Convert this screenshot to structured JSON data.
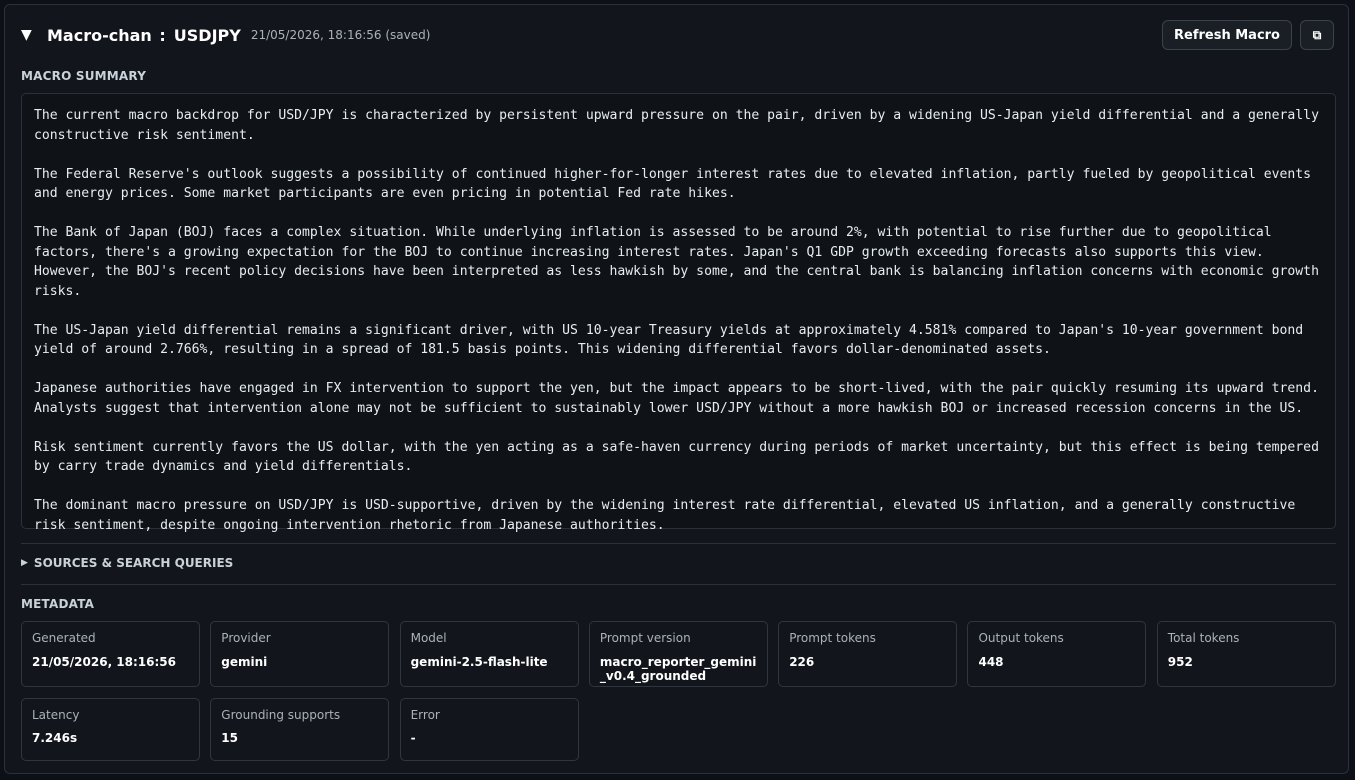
{
  "header": {
    "title": "Macro-chan",
    "separator": ":",
    "symbol": "USDJPY",
    "timestamp": "21/05/2026, 18:16:56 (saved)",
    "toggle_glyph": "▼",
    "refresh_label": "Refresh Macro",
    "copy_glyph": "⧉",
    "copy_icon": "copy-icon"
  },
  "summary": {
    "label": "MACRO SUMMARY",
    "paragraphs": [
      "The current macro backdrop for USD/JPY is characterized by persistent upward pressure on the pair, driven by a widening US-Japan yield differential and a generally constructive risk sentiment.",
      "The Federal Reserve's outlook suggests a possibility of continued higher-for-longer interest rates due to elevated inflation, partly fueled by geopolitical events and energy prices. Some market participants are even pricing in potential Fed rate hikes.",
      "The Bank of Japan (BOJ) faces a complex situation. While underlying inflation is assessed to be around 2%, with potential to rise further due to geopolitical factors, there's a growing expectation for the BOJ to continue increasing interest rates. Japan's Q1 GDP growth exceeding forecasts also supports this view. However, the BOJ's recent policy decisions have been interpreted as less hawkish by some, and the central bank is balancing inflation concerns with economic growth risks.",
      "The US-Japan yield differential remains a significant driver, with US 10-year Treasury yields at approximately 4.581% compared to Japan's 10-year government bond yield of around 2.766%, resulting in a spread of 181.5 basis points. This widening differential favors dollar-denominated assets.",
      "Japanese authorities have engaged in FX intervention to support the yen, but the impact appears to be short-lived, with the pair quickly resuming its upward trend. Analysts suggest that intervention alone may not be sufficient to sustainably lower USD/JPY without a more hawkish BOJ or increased recession concerns in the US.",
      "Risk sentiment currently favors the US dollar, with the yen acting as a safe-haven currency during periods of market uncertainty, but this effect is being tempered by carry trade dynamics and yield differentials.",
      "The dominant macro pressure on USD/JPY is USD-supportive, driven by the widening interest rate differential, elevated US inflation, and a generally constructive risk sentiment, despite ongoing intervention rhetoric from Japanese authorities."
    ]
  },
  "sources": {
    "label": "SOURCES & SEARCH QUERIES",
    "glyph": "▶"
  },
  "metadata": {
    "label": "METADATA",
    "items": [
      {
        "key": "Generated",
        "value": "21/05/2026, 18:16:56"
      },
      {
        "key": "Provider",
        "value": "gemini"
      },
      {
        "key": "Model",
        "value": "gemini-2.5-flash-lite"
      },
      {
        "key": "Prompt version",
        "value": "macro_reporter_gemini_v0.4_grounded"
      },
      {
        "key": "Prompt tokens",
        "value": "226"
      },
      {
        "key": "Output tokens",
        "value": "448"
      },
      {
        "key": "Total tokens",
        "value": "952"
      },
      {
        "key": "Latency",
        "value": "7.246s"
      },
      {
        "key": "Grounding supports",
        "value": "15"
      },
      {
        "key": "Error",
        "value": "-"
      }
    ]
  }
}
